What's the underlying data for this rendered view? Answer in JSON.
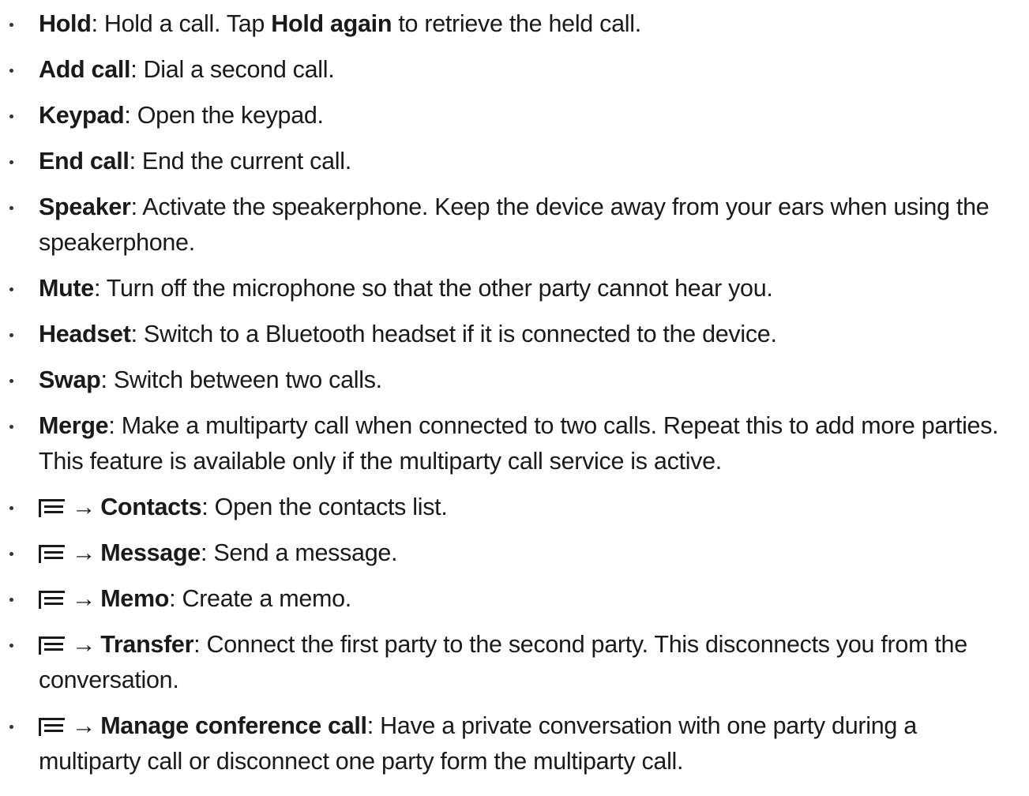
{
  "items": [
    {
      "term": "Hold",
      "parts": [
        ": Hold a call. Tap ",
        "Hold again",
        " to retrieve the held call."
      ]
    },
    {
      "term": "Add call",
      "desc": ": Dial a second call."
    },
    {
      "term": "Keypad",
      "desc": ": Open the keypad."
    },
    {
      "term": "End call",
      "desc": ": End the current call."
    },
    {
      "term": "Speaker",
      "desc": ": Activate the speakerphone. Keep the device away from your ears when using the speakerphone."
    },
    {
      "term": "Mute",
      "desc": ": Turn off the microphone so that the other party cannot hear you."
    },
    {
      "term": "Headset",
      "desc": ": Switch to a Bluetooth headset if it is connected to the device."
    },
    {
      "term": "Swap",
      "desc": ": Switch between two calls."
    },
    {
      "term": "Merge",
      "desc": ": Make a multiparty call when connected to two calls. Repeat this to add more parties. This feature is available only if the multiparty call service is active."
    },
    {
      "icon": "menu-icon",
      "arrow": "→",
      "term": "Contacts",
      "desc": ": Open the contacts list."
    },
    {
      "icon": "menu-icon",
      "arrow": "→",
      "term": "Message",
      "desc": ": Send a message."
    },
    {
      "icon": "menu-icon",
      "arrow": "→",
      "term": "Memo",
      "desc": ": Create a memo."
    },
    {
      "icon": "menu-icon",
      "arrow": "→",
      "term": "Transfer",
      "desc": ": Connect the first party to the second party. This disconnects you from the conversation."
    },
    {
      "icon": "menu-icon",
      "arrow": "→",
      "term": "Manage conference call",
      "desc": ": Have a private conversation with one party during a multiparty call or disconnect one party form the multiparty call."
    }
  ]
}
